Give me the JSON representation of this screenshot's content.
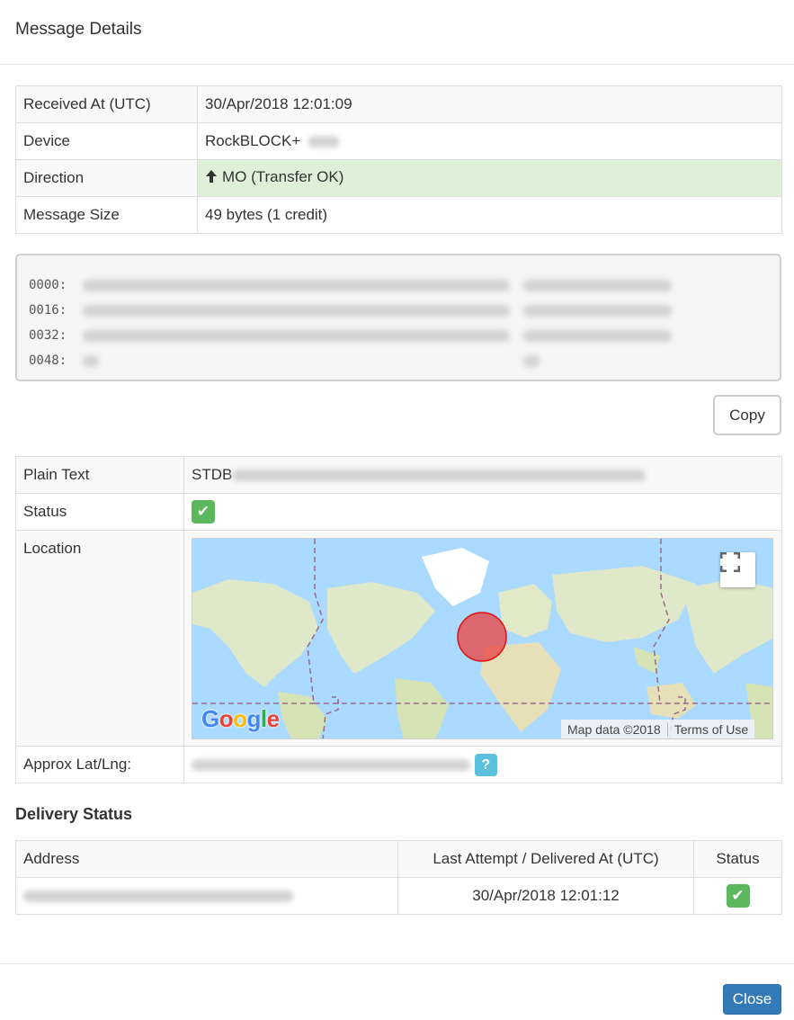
{
  "modal": {
    "title": "Message Details",
    "close_label": "Close"
  },
  "info": {
    "rows": [
      {
        "label": "Received At (UTC)",
        "value": "30/Apr/2018 12:01:09"
      },
      {
        "label": "Device",
        "value": "RockBLOCK+"
      },
      {
        "label": "Direction",
        "value": "MO (Transfer OK)",
        "icon": "arrow-up-icon"
      },
      {
        "label": "Message Size",
        "value": "49 bytes (1 credit)"
      }
    ]
  },
  "hex": {
    "offsets": [
      "0000:",
      "0016:",
      "0032:",
      "0048:"
    ]
  },
  "copy_label": "Copy",
  "details": {
    "plain_text_label": "Plain Text",
    "plain_text_value": "STDB",
    "status_label": "Status",
    "location_label": "Location",
    "latlng_label": "Approx Lat/Lng:",
    "help_icon": "?"
  },
  "map": {
    "logo": "Google",
    "data_label": "Map data ©2018",
    "terms_label": "Terms of Use"
  },
  "delivery": {
    "heading": "Delivery Status",
    "columns": [
      "Address",
      "Last Attempt / Delivered At (UTC)",
      "Status"
    ],
    "rows": [
      {
        "delivered_at": "30/Apr/2018 12:01:12"
      }
    ]
  },
  "colors": {
    "success": "#5cb85c",
    "success_row": "#dff0d8",
    "primary": "#337ab7",
    "info": "#5bc0de",
    "ocean": "#aadaff"
  }
}
